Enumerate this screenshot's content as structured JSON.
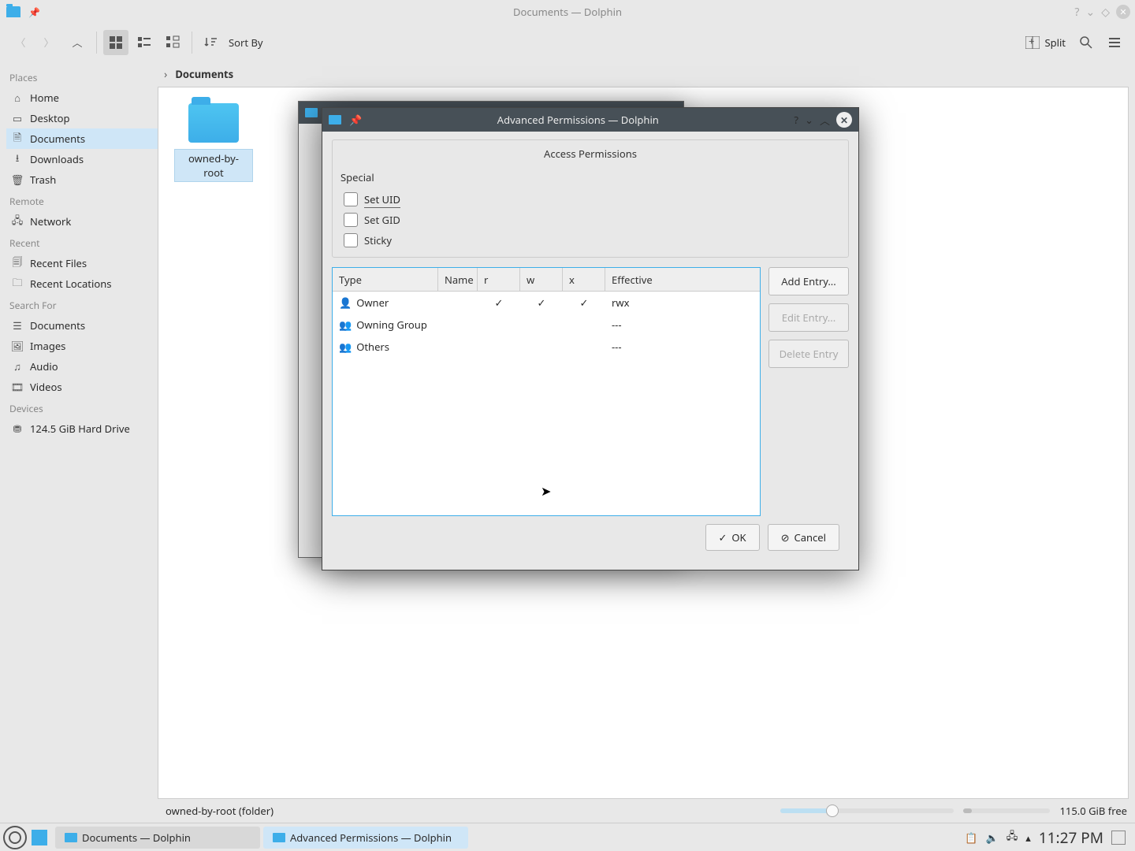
{
  "window": {
    "title": "Documents — Dolphin"
  },
  "toolbar": {
    "sort_label": "Sort By",
    "split_label": "Split"
  },
  "breadcrumb": {
    "current": "Documents"
  },
  "sidebar": {
    "places_head": "Places",
    "remote_head": "Remote",
    "recent_head": "Recent",
    "search_head": "Search For",
    "devices_head": "Devices",
    "places": [
      {
        "label": "Home"
      },
      {
        "label": "Desktop"
      },
      {
        "label": "Documents"
      },
      {
        "label": "Downloads"
      },
      {
        "label": "Trash"
      }
    ],
    "remote": [
      {
        "label": "Network"
      }
    ],
    "recent": [
      {
        "label": "Recent Files"
      },
      {
        "label": "Recent Locations"
      }
    ],
    "search": [
      {
        "label": "Documents"
      },
      {
        "label": "Images"
      },
      {
        "label": "Audio"
      },
      {
        "label": "Videos"
      }
    ],
    "devices": [
      {
        "label": "124.5 GiB Hard Drive"
      }
    ]
  },
  "file": {
    "name": "owned-by-root"
  },
  "status": {
    "left": "owned-by-root (folder)",
    "right": "115.0 GiB free"
  },
  "dialog": {
    "title": "Advanced Permissions — Dolphin",
    "group": "Access Permissions",
    "special": "Special",
    "setuid": "Set UID",
    "setgid": "Set GID",
    "sticky": "Sticky",
    "cols": {
      "type": "Type",
      "name": "Name",
      "r": "r",
      "w": "w",
      "x": "x",
      "eff": "Effective"
    },
    "rows": [
      {
        "type": "Owner",
        "r": "✓",
        "w": "✓",
        "x": "✓",
        "eff": "rwx"
      },
      {
        "type": "Owning Group",
        "r": "",
        "w": "",
        "x": "",
        "eff": "---"
      },
      {
        "type": "Others",
        "r": "",
        "w": "",
        "x": "",
        "eff": "---"
      }
    ],
    "add": "Add Entry...",
    "edit": "Edit Entry...",
    "del": "Delete Entry",
    "ok": "OK",
    "cancel": "Cancel"
  },
  "taskbar": {
    "t1": "Documents — Dolphin",
    "t2": "Advanced Permissions — Dolphin",
    "clock": "11:27 PM"
  }
}
